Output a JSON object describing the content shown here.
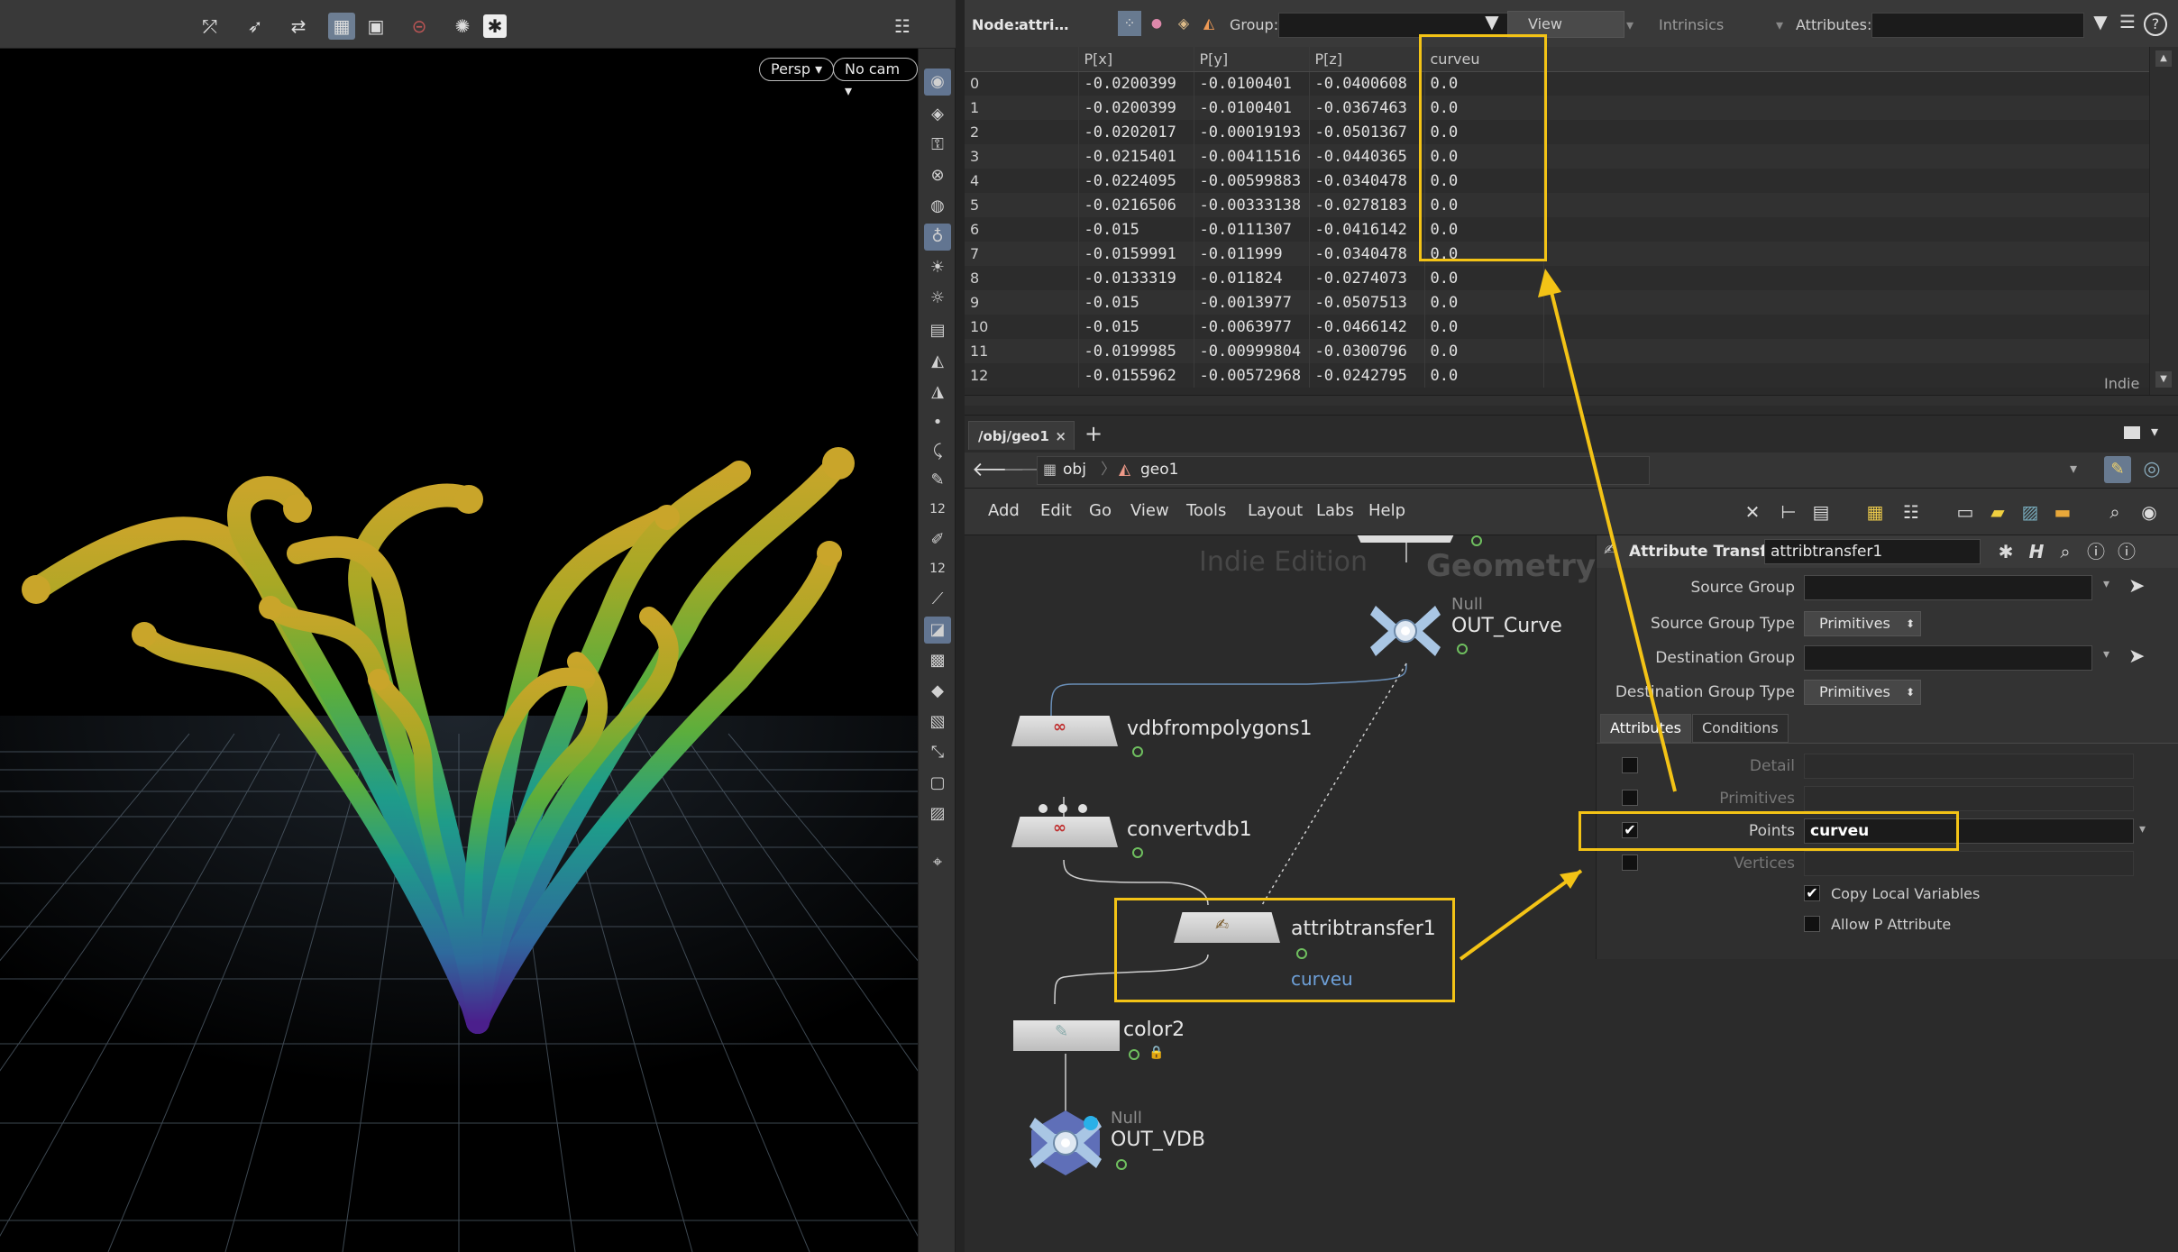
{
  "viewport": {
    "camera_label": "Persp",
    "cam_select_label": "No cam"
  },
  "spreadsheet": {
    "node_label": "Node:",
    "node_name": "attri…",
    "group_label": "Group:",
    "view_label": "View",
    "intrinsics_label": "Intrinsics",
    "attributes_label": "Attributes:",
    "columns": [
      "",
      "P[x]",
      "P[y]",
      "P[z]",
      "curveu"
    ],
    "rows": [
      [
        "0",
        "-0.0200399",
        "-0.0100401",
        "-0.0400608",
        "0.0"
      ],
      [
        "1",
        "-0.0200399",
        "-0.0100401",
        "-0.0367463",
        "0.0"
      ],
      [
        "2",
        "-0.0202017",
        "-0.00019193",
        "-0.0501367",
        "0.0"
      ],
      [
        "3",
        "-0.0215401",
        "-0.00411516",
        "-0.0440365",
        "0.0"
      ],
      [
        "4",
        "-0.0224095",
        "-0.00599883",
        "-0.0340478",
        "0.0"
      ],
      [
        "5",
        "-0.0216506",
        "-0.00333138",
        "-0.0278183",
        "0.0"
      ],
      [
        "6",
        "-0.015",
        "-0.0111307",
        "-0.0416142",
        "0.0"
      ],
      [
        "7",
        "-0.0159991",
        "-0.011999",
        "-0.0340478",
        "0.0"
      ],
      [
        "8",
        "-0.0133319",
        "-0.011824",
        "-0.0274073",
        "0.0"
      ],
      [
        "9",
        "-0.015",
        "-0.0013977",
        "-0.0507513",
        "0.0"
      ],
      [
        "10",
        "-0.015",
        "-0.0063977",
        "-0.0466142",
        "0.0"
      ],
      [
        "11",
        "-0.0199985",
        "-0.00999804",
        "-0.0300796",
        "0.0"
      ],
      [
        "12",
        "-0.0155962",
        "-0.00572968",
        "-0.0242795",
        "0.0"
      ]
    ],
    "edition": "Indie"
  },
  "network": {
    "tab_label": "/obj/geo1",
    "add_tab": "+",
    "path": [
      "obj",
      "geo1"
    ],
    "menu": [
      "Add",
      "Edit",
      "Go",
      "View",
      "Tools",
      "Layout",
      "Labs",
      "Help"
    ],
    "watermark_edition": "Indie Edition",
    "watermark_context": "Geometry",
    "nodes": {
      "out_curve": {
        "type": "Null",
        "name": "OUT_Curve"
      },
      "vdbfrompolygons": {
        "name": "vdbfrompolygons1"
      },
      "convertvdb": {
        "name": "convertvdb1"
      },
      "attribtransfer": {
        "name": "attribtransfer1",
        "comment": "curveu"
      },
      "color": {
        "name": "color2"
      },
      "out_vdb": {
        "type": "Null",
        "name": "OUT_VDB"
      }
    }
  },
  "params": {
    "node_type": "Attribute Transfer",
    "node_name": "attribtransfer1",
    "source_group_label": "Source Group",
    "source_group_type_label": "Source Group Type",
    "source_group_type": "Primitives",
    "dest_group_label": "Destination Group",
    "dest_group_type_label": "Destination Group Type",
    "dest_group_type": "Primitives",
    "tabs": [
      "Attributes",
      "Conditions"
    ],
    "detail_label": "Detail",
    "primitives_label": "Primitives",
    "points_label": "Points",
    "points_value": "curveu",
    "vertices_label": "Vertices",
    "copy_local_label": "Copy Local Variables",
    "allow_p_label": "Allow P Attribute",
    "check_glyph": "✔"
  },
  "colors": {
    "highlight": "#f3c316",
    "node_ring": "#6fbf5f",
    "viewport_bg": "#000000"
  }
}
